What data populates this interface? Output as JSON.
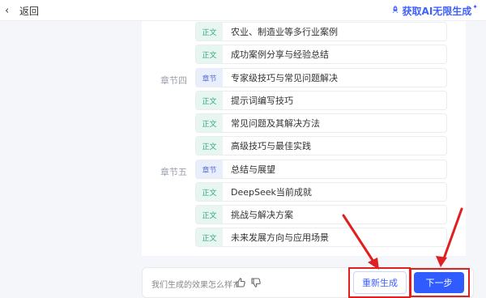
{
  "header": {
    "back_label": "返回",
    "ai_link_label": "获取AI无限生成",
    "star": "✦"
  },
  "chapter_labels": [
    "章节四",
    "章节五"
  ],
  "outline_rows": [
    {
      "tag": "正文",
      "kind": "body",
      "text": "农业、制造业等多行业案例"
    },
    {
      "tag": "正文",
      "kind": "body",
      "text": "成功案例分享与经验总结"
    },
    {
      "tag": "章节",
      "kind": "chapter",
      "text": "专家级技巧与常见问题解决"
    },
    {
      "tag": "正文",
      "kind": "body",
      "text": "提示词编写技巧"
    },
    {
      "tag": "正文",
      "kind": "body",
      "text": "常见问题及其解决方法"
    },
    {
      "tag": "正文",
      "kind": "body",
      "text": "高级技巧与最佳实践"
    },
    {
      "tag": "章节",
      "kind": "chapter",
      "text": "总结与展望"
    },
    {
      "tag": "正文",
      "kind": "body",
      "text": "DeepSeek当前成就"
    },
    {
      "tag": "正文",
      "kind": "body",
      "text": "挑战与解决方案"
    },
    {
      "tag": "正文",
      "kind": "body",
      "text": "未来发展方向与应用场景"
    }
  ],
  "feedback": {
    "question": "我们生成的效果怎么样?"
  },
  "actions": {
    "regenerate_label": "重新生成",
    "next_label": "下一步"
  },
  "colors": {
    "accent": "#2f5bff",
    "highlight": "#e02020"
  }
}
